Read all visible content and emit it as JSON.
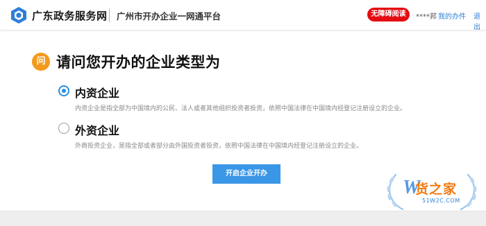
{
  "header": {
    "brand": "广东政务服务网",
    "subtitle": "广州市开办企业一网通平台",
    "accessibility_label": "无障碍阅读",
    "user_name": "****邦",
    "my_tasks_label": "我的办件",
    "logout_label": "退出"
  },
  "question": {
    "badge": "问",
    "title": "请问您开办的企业类型为"
  },
  "options": [
    {
      "label": "内资企业",
      "selected": true,
      "description": "内资企业是指全部为中国境内的公民、法人或者其他组织投资者投资，依照中国法律在中国境内经登记注册设立的企业。"
    },
    {
      "label": "外资企业",
      "selected": false,
      "description": "外商投资企业，是指全部或者部分由外国投资者投资，依照中国法律在中国境内经登记注册设立的企业。"
    }
  ],
  "start_button": "开启企业开办",
  "watermark": {
    "brand_text": "货之家",
    "url": "51W2C.COM"
  },
  "colors": {
    "accent": "#3a96e6",
    "badge": "#f39a1e",
    "access_button": "#e40c12",
    "link": "#2f7fd6"
  }
}
